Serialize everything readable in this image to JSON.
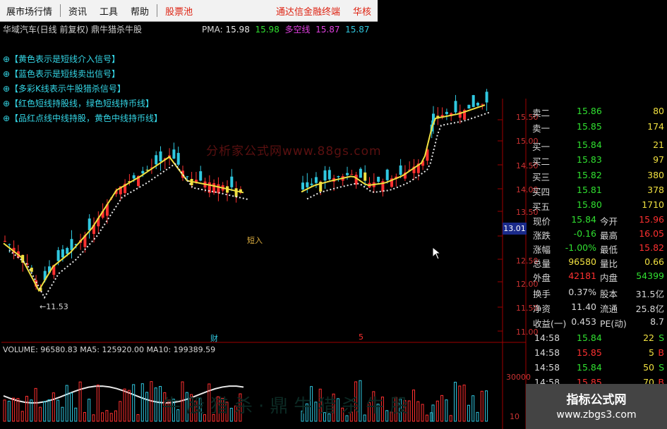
{
  "menu": {
    "items": [
      "展市场行情",
      "资讯",
      "工具",
      "帮助"
    ],
    "stock_pool": "股票池",
    "broker_links": [
      "通达信金融终端",
      "华核"
    ]
  },
  "chart": {
    "title": "华域汽车(日线 前复权) 鼎牛猎杀牛股",
    "pma_label": "PMA:",
    "pma_values": [
      "15.98",
      "15.98",
      "15.87",
      "15.87"
    ],
    "pma_line_name": "多空线",
    "notes": [
      "⊕【黄色表示是短线介入信号】",
      "⊕【蓝色表示是短线卖出信号】",
      "⊕【多彩K线表示牛股猎杀信号】",
      "⊕【红色短线持股线，绿色短线持币线】",
      "⊕【品红点线中线持股，黄色中线持币线】"
    ],
    "low_label": "←11.53",
    "buy_label": "短入",
    "event_label": "财",
    "event_label2": "5",
    "watermark": "分析家公式网www.88gs.com",
    "price_axis": [
      "15.50",
      "15.00",
      "14.50",
      "14.00",
      "13.50",
      "13.01",
      "12.50",
      "12.00",
      "11.50",
      "11.00"
    ],
    "current_price_marker": "13.01",
    "volume_legend": "VOLUME: 96580.83  MA5: 125920.00  MA10: 199389.59",
    "volume_axis": [
      "30000"
    ],
    "volume_axis_bottom": "10",
    "bottom_watermark": "牛股猎杀·鼎牛猎杀牛股"
  },
  "quote": {
    "order_book": [
      {
        "label": "卖二",
        "price": "15.86",
        "vol": "80",
        "side": "ask"
      },
      {
        "label": "卖一",
        "price": "15.85",
        "vol": "174",
        "side": "ask"
      },
      {
        "label": "买一",
        "price": "15.84",
        "vol": "21",
        "side": "bid"
      },
      {
        "label": "买二",
        "price": "15.83",
        "vol": "97",
        "side": "bid"
      },
      {
        "label": "买三",
        "price": "15.82",
        "vol": "380",
        "side": "bid"
      },
      {
        "label": "买四",
        "price": "15.81",
        "vol": "378",
        "side": "bid"
      },
      {
        "label": "买五",
        "price": "15.80",
        "vol": "1710",
        "side": "bid"
      }
    ],
    "stats": [
      {
        "l1": "现价",
        "v1": "15.84",
        "l2": "今开",
        "v2": "15.96"
      },
      {
        "l1": "涨跌",
        "v1": "-0.16",
        "l2": "最高",
        "v2": "16.05"
      },
      {
        "l1": "涨幅",
        "v1": "-1.00%",
        "l2": "最低",
        "v2": "15.82"
      },
      {
        "l1": "总量",
        "v1": "96580",
        "l2": "量比",
        "v2": "0.66"
      },
      {
        "l1": "外盘",
        "v1": "42181",
        "l2": "内盘",
        "v2": "54399"
      }
    ],
    "stats2": [
      {
        "l1": "换手",
        "v1": "0.37%",
        "l2": "股本",
        "v2": "31.5亿"
      },
      {
        "l1": "净资",
        "v1": "11.40",
        "l2": "流通",
        "v2": "25.8亿"
      },
      {
        "l1": "收益(一)",
        "v1": "0.453",
        "l2": "PE(动)",
        "v2": "8.7"
      }
    ],
    "ticks": [
      {
        "time": "14:58",
        "price": "15.84",
        "vol": "22",
        "bs": "S"
      },
      {
        "time": "14:58",
        "price": "15.85",
        "vol": "5",
        "bs": "B"
      },
      {
        "time": "14:58",
        "price": "15.84",
        "vol": "50",
        "bs": "S"
      },
      {
        "time": "14:58",
        "price": "15.85",
        "vol": "70",
        "bs": "B"
      }
    ]
  },
  "site_watermark": {
    "title": "指标公式网",
    "url": "www.zbgs3.com"
  },
  "colors": {
    "up": "#ff3030",
    "down": "#30c8e0",
    "ma_yellow": "#f0e040",
    "ma_white": "#e8e8e8",
    "ma_magenta": "#e040e0",
    "axis_red": "#a00000",
    "price_green": "#30e030",
    "price_red": "#ff3030"
  }
}
